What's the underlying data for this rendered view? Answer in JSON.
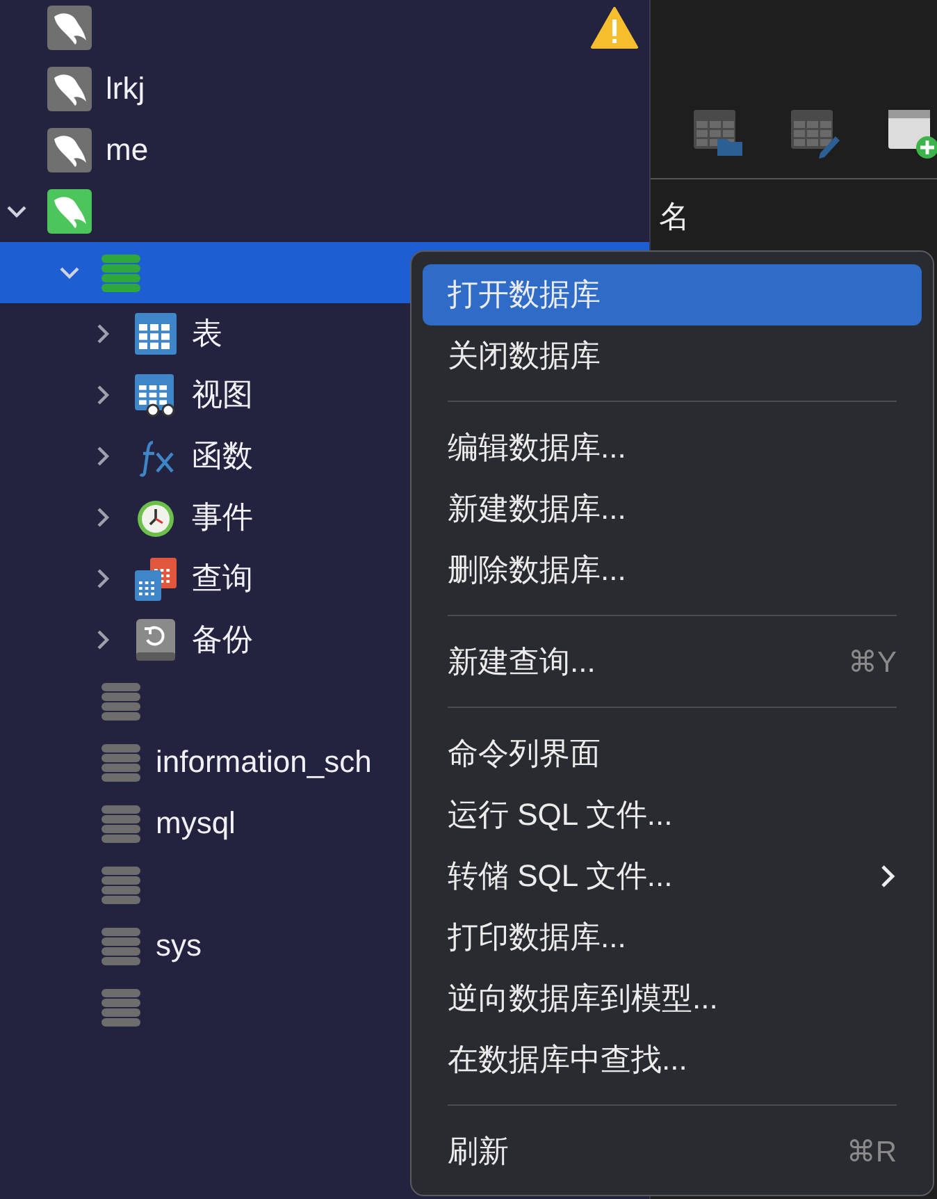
{
  "sidebar": {
    "connections": [
      {
        "connected": false,
        "warning": true,
        "expanded": false
      },
      {
        "name": "lrkj",
        "connected": false,
        "warning": false,
        "expanded": false
      },
      {
        "name": "me",
        "connected": false,
        "warning": false,
        "expanded": false
      },
      {
        "connected": true,
        "warning": false,
        "expanded": true,
        "databases": [
          {
            "open": true,
            "selected": true,
            "expanded": true,
            "children": [
              {
                "label": "表",
                "kind": "table",
                "expanded": false
              },
              {
                "label": "视图",
                "kind": "view",
                "expanded": false
              },
              {
                "label": "函数",
                "kind": "function",
                "expanded": false
              },
              {
                "label": "事件",
                "kind": "event",
                "expanded": false
              },
              {
                "label": "查询",
                "kind": "query",
                "expanded": false
              },
              {
                "label": "备份",
                "kind": "backup",
                "expanded": false
              }
            ]
          },
          {
            "open": false,
            "selected": false,
            "expanded": false
          },
          {
            "name": "information_sch",
            "open": false,
            "selected": false,
            "expanded": false
          },
          {
            "name": "mysql",
            "open": false,
            "selected": false,
            "expanded": false
          },
          {
            "open": false,
            "selected": false,
            "expanded": false
          },
          {
            "name": "sys",
            "open": false,
            "selected": false,
            "expanded": false
          },
          {
            "open": false,
            "selected": false,
            "expanded": false
          }
        ]
      }
    ]
  },
  "object_panel": {
    "column_header": "名"
  },
  "context_menu": [
    {
      "kind": "item",
      "label": "打开数据库",
      "selected": true
    },
    {
      "kind": "item",
      "label": "关闭数据库",
      "selected": false
    },
    {
      "kind": "separator"
    },
    {
      "kind": "item",
      "label": "编辑数据库...",
      "selected": false
    },
    {
      "kind": "item",
      "label": "新建数据库...",
      "selected": false
    },
    {
      "kind": "item",
      "label": "删除数据库...",
      "selected": false
    },
    {
      "kind": "separator"
    },
    {
      "kind": "item",
      "label": "新建查询...",
      "shortcut": "⌘Y",
      "selected": false
    },
    {
      "kind": "separator"
    },
    {
      "kind": "item",
      "label": "命令列界面",
      "selected": false
    },
    {
      "kind": "item",
      "label": "运行 SQL 文件...",
      "selected": false
    },
    {
      "kind": "item",
      "label": "转储 SQL 文件...",
      "submenu": true,
      "selected": false
    },
    {
      "kind": "item",
      "label": "打印数据库...",
      "selected": false
    },
    {
      "kind": "item",
      "label": "逆向数据库到模型...",
      "selected": false
    },
    {
      "kind": "item",
      "label": "在数据库中查找...",
      "selected": false
    },
    {
      "kind": "separator"
    },
    {
      "kind": "item",
      "label": "刷新",
      "shortcut": "⌘R",
      "selected": false
    }
  ]
}
